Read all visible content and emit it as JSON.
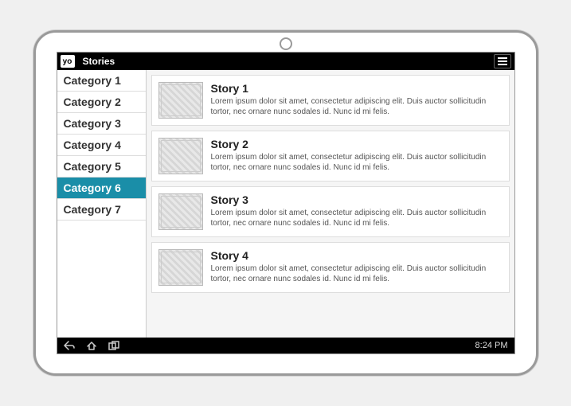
{
  "header": {
    "logo_text": "yo",
    "title": "Stories"
  },
  "sidebar": {
    "items": [
      {
        "label": "Category 1",
        "selected": false
      },
      {
        "label": "Category 2",
        "selected": false
      },
      {
        "label": "Category 3",
        "selected": false
      },
      {
        "label": "Category 4",
        "selected": false
      },
      {
        "label": "Category 5",
        "selected": false
      },
      {
        "label": "Category 6",
        "selected": true
      },
      {
        "label": "Category 7",
        "selected": false
      }
    ]
  },
  "stories": [
    {
      "title": "Story 1",
      "desc": "Lorem ipsum dolor sit amet, consectetur adipiscing elit. Duis auctor sollicitudin tortor, nec ornare nunc sodales id. Nunc id mi felis."
    },
    {
      "title": "Story 2",
      "desc": "Lorem ipsum dolor sit amet, consectetur adipiscing elit. Duis auctor sollicitudin tortor, nec ornare nunc sodales id. Nunc id mi felis."
    },
    {
      "title": "Story 3",
      "desc": "Lorem ipsum dolor sit amet, consectetur adipiscing elit. Duis auctor sollicitudin tortor, nec ornare nunc sodales id. Nunc id mi felis."
    },
    {
      "title": "Story 4",
      "desc": "Lorem ipsum dolor sit amet, consectetur adipiscing elit. Duis auctor sollicitudin tortor, nec ornare nunc sodales id. Nunc id mi felis."
    }
  ],
  "footer": {
    "clock": "8:24 PM"
  }
}
